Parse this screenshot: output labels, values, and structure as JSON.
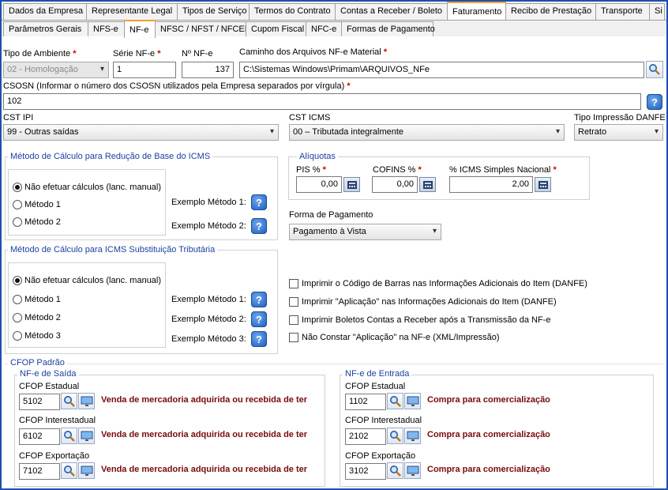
{
  "top_tabs": [
    {
      "label": "Dados da Empresa",
      "active": false
    },
    {
      "label": "Representante Legal",
      "active": false
    },
    {
      "label": "Tipos de Serviço",
      "active": false
    },
    {
      "label": "Termos do Contrato",
      "active": false
    },
    {
      "label": "Contas a Receber / Boleto",
      "active": false
    },
    {
      "label": "Faturamento",
      "active": true
    },
    {
      "label": "Recibo de Prestação",
      "active": false
    },
    {
      "label": "Transporte",
      "active": false
    },
    {
      "label": "Si",
      "active": false
    }
  ],
  "sub_tabs": [
    {
      "label": "Parâmetros Gerais",
      "active": false
    },
    {
      "label": "NFS-e",
      "active": false
    },
    {
      "label": "NF-e",
      "active": true
    },
    {
      "label": "NFSC / NFST / NFCEE",
      "active": false
    },
    {
      "label": "Cupom Fiscal",
      "active": false
    },
    {
      "label": "NFC-e",
      "active": false
    },
    {
      "label": "Formas de Pagamento",
      "active": false
    }
  ],
  "required_marker": "*",
  "ambiente": {
    "label": "Tipo de Ambiente",
    "value": "02 - Homologação"
  },
  "serie": {
    "label": "Série NF-e",
    "value": "1"
  },
  "numero": {
    "label": "Nº NF-e",
    "value": "137"
  },
  "caminho": {
    "label": "Caminho dos Arquivos NF-e Material",
    "value": "C:\\Sistemas Windows\\Primam\\ARQUIVOS_NFe"
  },
  "csosn": {
    "label": "CSOSN (Informar o número dos CSOSN utilizados pela Empresa separados por vírgula)",
    "value": "102"
  },
  "cst_ipi": {
    "label": "CST IPI",
    "value": "99 - Outras saídas"
  },
  "cst_icms": {
    "label": "CST ICMS",
    "value": "00 – Tributada integralmente"
  },
  "tipo_danfe": {
    "label": "Tipo Impressão DANFE",
    "value": "Retrato"
  },
  "metodo_reducao": {
    "title": "Método de Cálculo para Redução de Base do ICMS",
    "options": [
      "Não efetuar cálculos (lanc. manual)",
      "Método 1",
      "Método 2"
    ],
    "examples": [
      "Exemplo Método 1:",
      "Exemplo Método 2:"
    ]
  },
  "metodo_st": {
    "title": "Método de Cálculo para ICMS Substituição Tributária",
    "options": [
      "Não efetuar cálculos (lanc. manual)",
      "Método 1",
      "Método 2",
      "Método 3"
    ],
    "examples": [
      "Exemplo Método 1:",
      "Exemplo Método 2:",
      "Exemplo Método 3:"
    ]
  },
  "aliquotas": {
    "title": "Alíquotas",
    "pis": {
      "label": "PIS %",
      "value": "0,00"
    },
    "cofins": {
      "label": "COFINS %",
      "value": "0,00"
    },
    "icms_simples": {
      "label": "% ICMS Simples Nacional",
      "value": "2,00"
    }
  },
  "forma_pagamento": {
    "label": "Forma de Pagamento",
    "value": "Pagamento à Vista"
  },
  "checkboxes": [
    "Imprimir o Código de Barras nas Informações Adicionais do Item (DANFE)",
    "Imprimir \"Aplicação\" nas Informações Adicionais do Item (DANFE)",
    "Imprimir Boletos Contas a Receber após a Transmissão da NF-e",
    "Não Constar \"Aplicação\" na NF-e (XML/Impressão)"
  ],
  "cfop": {
    "title": "CFOP Padrão",
    "saida": {
      "title": "NF-e de Saída",
      "rows": [
        {
          "label": "CFOP Estadual",
          "code": "5102",
          "desc": "Venda de mercadoria adquirida ou recebida de ter"
        },
        {
          "label": "CFOP Interestadual",
          "code": "6102",
          "desc": "Venda de mercadoria adquirida ou recebida de ter"
        },
        {
          "label": "CFOP Exportação",
          "code": "7102",
          "desc": "Venda de mercadoria adquirida ou recebida de ter"
        }
      ]
    },
    "entrada": {
      "title": "NF-e de Entrada",
      "rows": [
        {
          "label": "CFOP Estadual",
          "code": "1102",
          "desc": "Compra para comercialização"
        },
        {
          "label": "CFOP Interestadual",
          "code": "2102",
          "desc": "Compra para comercialização"
        },
        {
          "label": "CFOP Exportação",
          "code": "3102",
          "desc": "Compra para comercialização"
        }
      ]
    }
  },
  "icons": {
    "help": "?",
    "search": "magnifier-icon",
    "monitor": "monitor-icon",
    "calculator": "calculator-icon",
    "chevron": "▾"
  },
  "colors": {
    "accent_tab": "#f0a030",
    "frame": "#1c4fb0",
    "group_title": "#1b3fa0",
    "desc_text": "#7a0a0a",
    "required": "#d00000"
  }
}
